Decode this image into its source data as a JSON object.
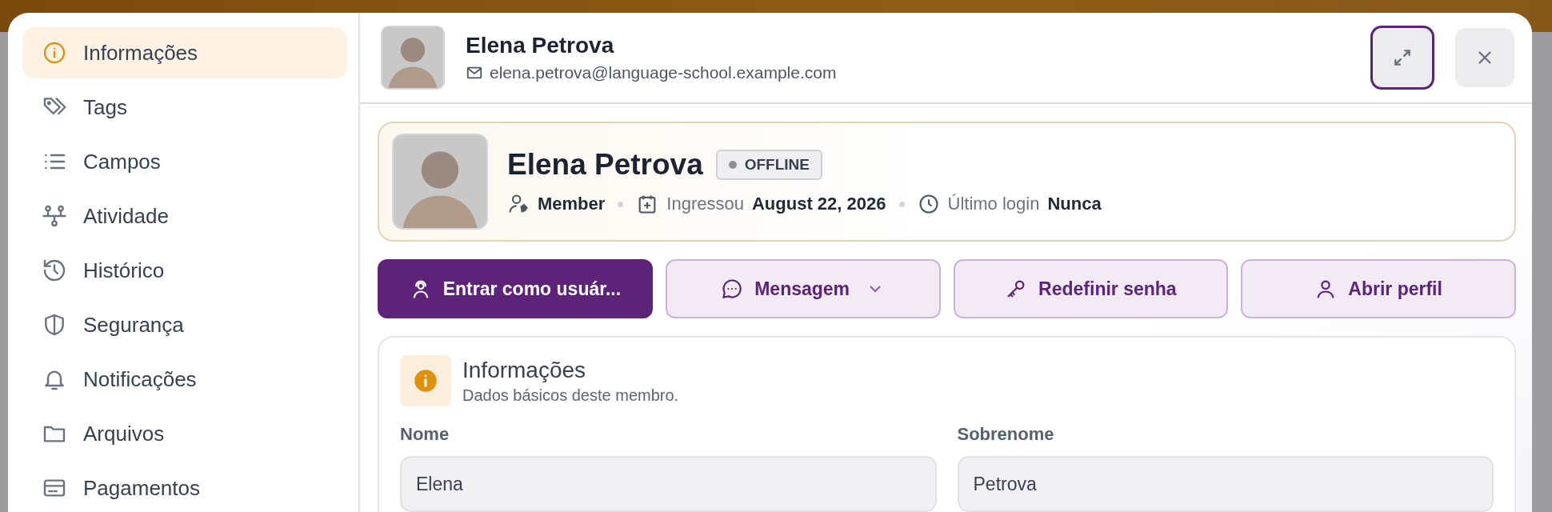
{
  "sidebar": {
    "items": [
      {
        "label": "Informações",
        "selected": true
      },
      {
        "label": "Tags",
        "selected": false
      },
      {
        "label": "Campos",
        "selected": false
      },
      {
        "label": "Atividade",
        "selected": false
      },
      {
        "label": "Histórico",
        "selected": false
      },
      {
        "label": "Segurança",
        "selected": false
      },
      {
        "label": "Notificações",
        "selected": false
      },
      {
        "label": "Arquivos",
        "selected": false
      },
      {
        "label": "Pagamentos",
        "selected": false
      }
    ]
  },
  "header": {
    "name": "Elena Petrova",
    "email": "elena.petrova@language-school.example.com"
  },
  "profile": {
    "name": "Elena Petrova",
    "status": "OFFLINE",
    "online": false,
    "role": "Member",
    "joined_label": "Ingressou",
    "joined": "August 22, 2026",
    "login_label": "Último login",
    "login": "Nunca"
  },
  "actions": [
    {
      "label": "Entrar como usuár...",
      "kind": "primary",
      "dropdown": false
    },
    {
      "label": "Mensagem",
      "kind": "secondary",
      "dropdown": true
    },
    {
      "label": "Redefinir senha",
      "kind": "secondary",
      "dropdown": false
    },
    {
      "label": "Abrir perfil",
      "kind": "secondary",
      "dropdown": false
    }
  ],
  "section": {
    "title": "Informações",
    "subtitle": "Dados básicos deste membro.",
    "fields": [
      {
        "label": "Nome",
        "value": "Elena"
      },
      {
        "label": "Sobrenome",
        "value": "Petrova"
      }
    ]
  }
}
